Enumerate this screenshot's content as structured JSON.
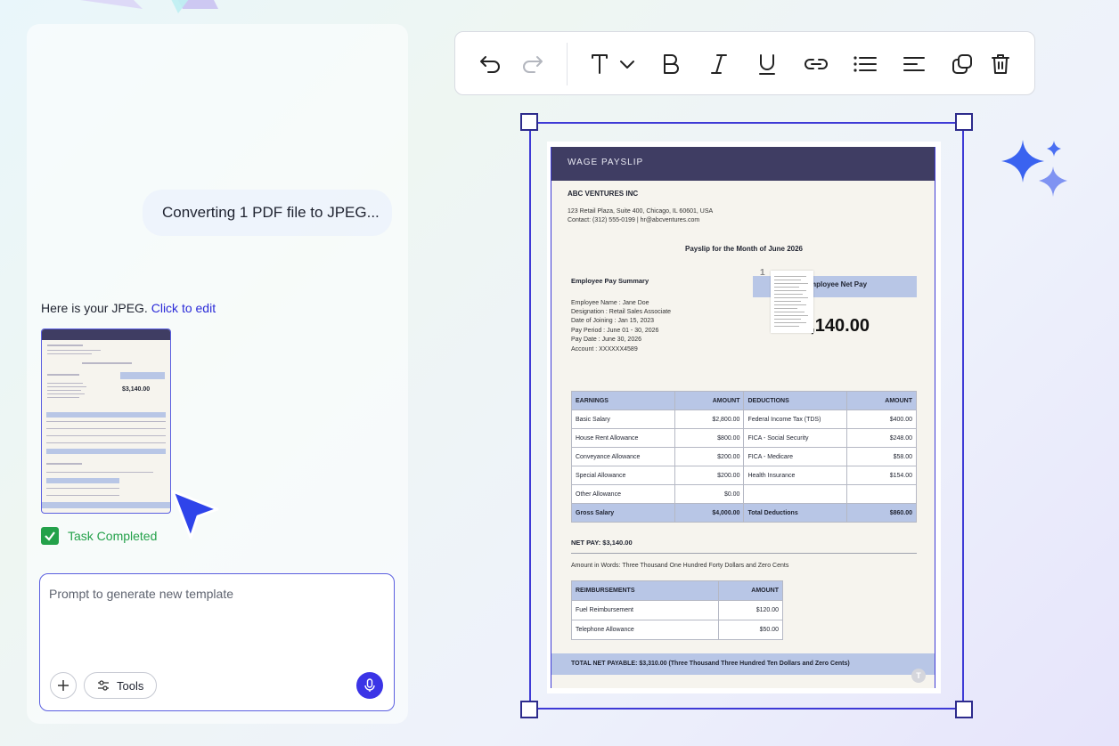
{
  "chat": {
    "status_message": "Converting 1 PDF file to JPEG...",
    "reply_text": "Here is your JPEG.",
    "reply_link": "Click to edit",
    "task_status": "Task Completed"
  },
  "prompt": {
    "placeholder": "Prompt to generate new template",
    "tools_label": "Tools"
  },
  "toolbar": {
    "icons": [
      "undo-icon",
      "redo-icon",
      "text-style-icon",
      "bold-icon",
      "italic-icon",
      "underline-icon",
      "link-icon",
      "list-icon",
      "align-icon",
      "duplicate-icon",
      "delete-icon"
    ]
  },
  "payslip": {
    "header": "WAGE PAYSLIP",
    "company": "ABC VENTURES INC",
    "address": "123 Retail Plaza, Suite 400, Chicago, IL 60601, USA",
    "contact": "Contact: (312) 555-0199 | hr@abcventures.com",
    "month_title": "Payslip for the Month of June 2026",
    "summary_title": "Employee Pay Summary",
    "employee": [
      "Employee Name : Jane Doe",
      "Designation : Retail Sales Associate",
      "Date of Joining : Jan 15, 2023",
      "Pay Period : June 01 - 30, 2026",
      "Pay Date : June 30, 2026",
      "Account : XXXXXX4589"
    ],
    "net_pay_label": "Employee Net Pay",
    "net_pay_label_visible": "mployee Net Pay",
    "net_pay_value": "$3,140.00",
    "net_pay_value_visible": ",140.00",
    "overlay_page_number": "1",
    "earnings_headers": [
      "EARNINGS",
      "AMOUNT",
      "DEDUCTIONS",
      "AMOUNT"
    ],
    "earnings_rows": [
      [
        "Basic Salary",
        "$2,800.00",
        "Federal Income Tax (TDS)",
        "$400.00"
      ],
      [
        "House Rent Allowance",
        "$800.00",
        "FICA - Social Security",
        "$248.00"
      ],
      [
        "Conveyance Allowance",
        "$200.00",
        "FICA - Medicare",
        "$58.00"
      ],
      [
        "Special Allowance",
        "$200.00",
        "Health Insurance",
        "$154.00"
      ],
      [
        "Other Allowance",
        "$0.00",
        "",
        ""
      ]
    ],
    "earnings_total": [
      "Gross Salary",
      "$4,000.00",
      "Total Deductions",
      "$860.00"
    ],
    "net_pay_line": "NET PAY:  $3,140.00",
    "amount_in_words": "Amount in Words: Three Thousand One Hundred Forty Dollars and Zero Cents",
    "reimb_headers": [
      "REIMBURSEMENTS",
      "AMOUNT"
    ],
    "reimb_rows": [
      [
        "Fuel Reimbursement",
        "$120.00"
      ],
      [
        "Telephone Allowance",
        "$50.00"
      ]
    ],
    "total_net_payable": "TOTAL NET PAYABLE:  $3,310.00  (Three Thousand Three Hundred Ten Dollars and Zero Cents)",
    "badge_letter": "T"
  },
  "thumbnail": {
    "net_value": "$3,140.00"
  },
  "colors": {
    "accent": "#3e3ad6",
    "success": "#24a14a",
    "header_dark": "#3f3d63",
    "table_blue": "#b8c6e6",
    "mic": "#3b34e6"
  }
}
